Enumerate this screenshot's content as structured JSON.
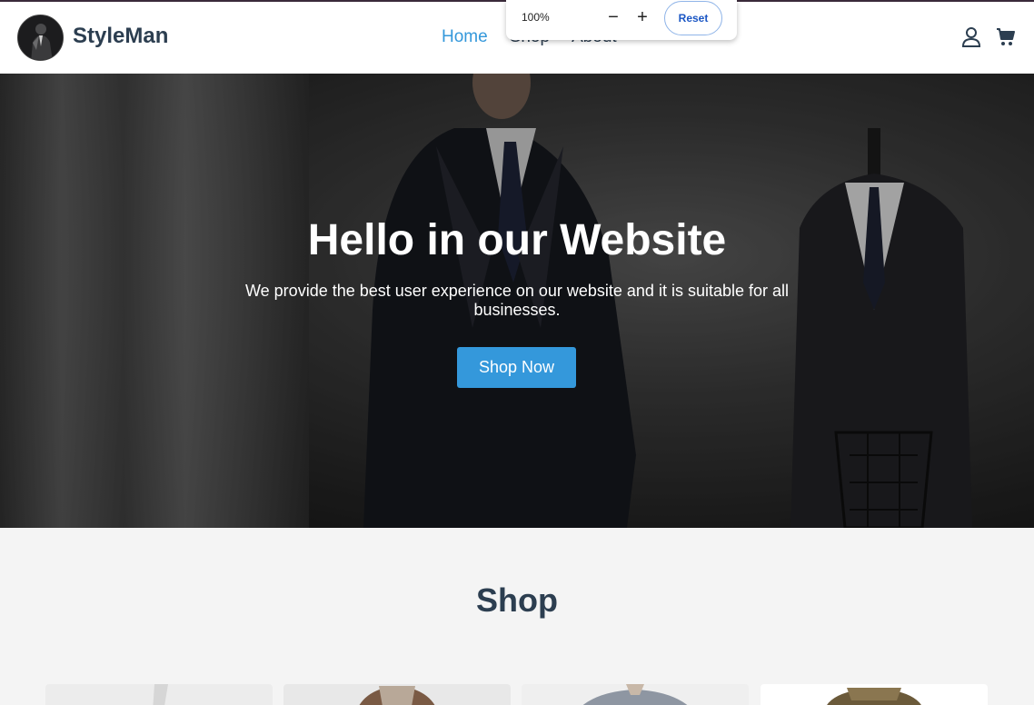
{
  "zoom": {
    "level": "100%",
    "minus": "−",
    "plus": "+",
    "reset": "Reset"
  },
  "header": {
    "brand": "StyleMan",
    "nav": [
      {
        "label": "Home",
        "active": true
      },
      {
        "label": "Shop",
        "active": false
      },
      {
        "label": "About",
        "active": false
      }
    ],
    "icons": [
      "user-icon",
      "cart-icon"
    ]
  },
  "hero": {
    "title": "Hello in our Website",
    "subtitle": "We provide the best user experience on our website and it is suitable for all businesses.",
    "cta": "Shop Now"
  },
  "shop": {
    "title": "Shop"
  },
  "colors": {
    "accent": "#3498db",
    "heading": "#2c3e50",
    "background": "#f4f4f4"
  }
}
